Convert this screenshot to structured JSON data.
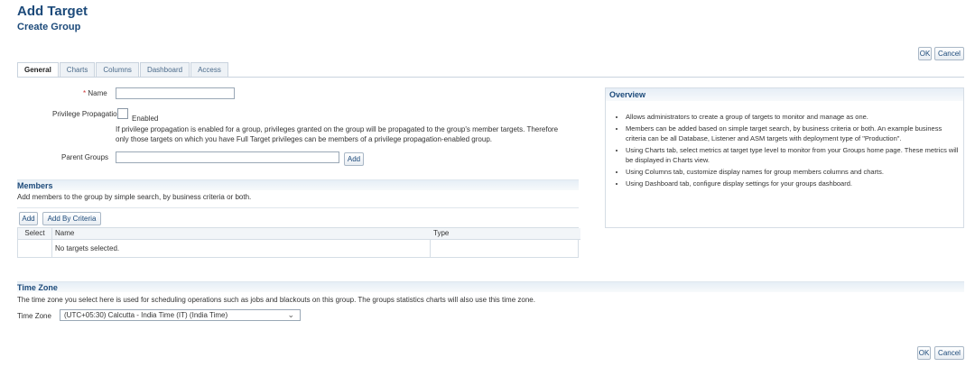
{
  "header": {
    "title": "Add Target",
    "subtitle": "Create Group"
  },
  "actions": {
    "ok": "OK",
    "cancel": "Cancel"
  },
  "tabs": [
    "General",
    "Charts",
    "Columns",
    "Dashboard",
    "Access"
  ],
  "general": {
    "name_required_marker": "*",
    "name_label": "Name",
    "name_value": "",
    "privilege_label": "Privilege Propagation",
    "privilege_checkbox_label": "Enabled",
    "privilege_help_1": "If privilege propagation is enabled for a group, privileges granted on the group will be propagated to the group's member targets. Therefore",
    "privilege_help_2": "only those targets on which you have Full Target privileges can be members of a privilege propagation-enabled group.",
    "parent_groups_label": "Parent Groups",
    "parent_groups_value": "",
    "add_button": "Add"
  },
  "members": {
    "title": "Members",
    "description": "Add members to the group by simple search, by business criteria or both.",
    "add_button": "Add",
    "add_by_criteria_button": "Add By Criteria",
    "columns": [
      "Select",
      "Name",
      "Type"
    ],
    "empty_message": "No targets selected."
  },
  "overview": {
    "title": "Overview",
    "items": [
      "Allows administrators to create a group of targets to monitor and manage as one.",
      "Members can be added based on simple target search, by business criteria or both. An example business criteria can be all Database, Listener and ASM targets with deployment type of \"Production\".",
      "Using Charts tab, select metrics at target type level to monitor from your Groups home page. These metrics will be displayed in Charts view.",
      "Using Columns tab, customize display names for group members columns and charts.",
      "Using Dashboard tab, configure display settings for your groups dashboard."
    ]
  },
  "timezone": {
    "title": "Time Zone",
    "description": "The time zone you select here is used for scheduling operations such as jobs and blackouts on this group. The groups statistics charts will also use this time zone.",
    "label": "Time Zone",
    "selected": "(UTC+05:30) Calcutta - India Time (IT) (India Time)"
  }
}
